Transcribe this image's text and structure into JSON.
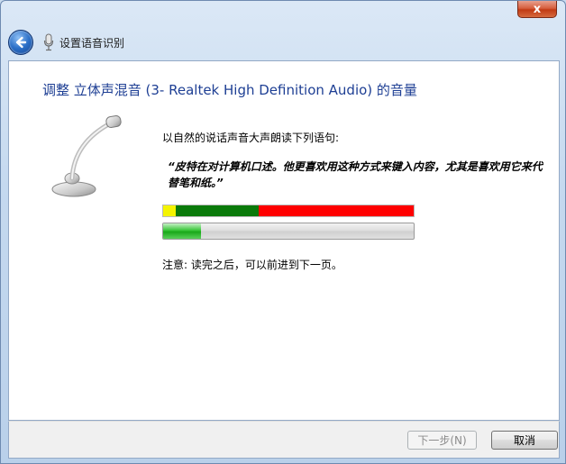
{
  "window": {
    "title": "设置语音识别",
    "close_symbol": "x",
    "icons": {
      "back": "back-arrow-icon",
      "app": "microphone-icon",
      "close": "close-icon"
    }
  },
  "main": {
    "heading": "调整 立体声混音 (3- Realtek High Definition Audio) 的音量",
    "instruction": "以自然的说话声音大声朗读下列语句:",
    "quote": "“皮特在对计算机口述。他更喜欢用这种方式来键入内容，尤其是喜欢用它来代替笔和纸。”",
    "note": "注意: 读完之后，可以前进到下一页。",
    "level_meter": {
      "segments": [
        {
          "color": "#f4f400",
          "fraction": 0.05
        },
        {
          "color": "#0a7a0a",
          "fraction": 0.33
        },
        {
          "color": "#ff0000",
          "fraction": 0.62
        }
      ]
    },
    "volume": {
      "level_fraction": 0.15,
      "color": "#22b322"
    }
  },
  "footer": {
    "next_label": "下一步(N)",
    "next_enabled": false,
    "cancel_label": "取消"
  },
  "colors": {
    "heading": "#1e3f94",
    "frame": "#c5d9ef"
  }
}
